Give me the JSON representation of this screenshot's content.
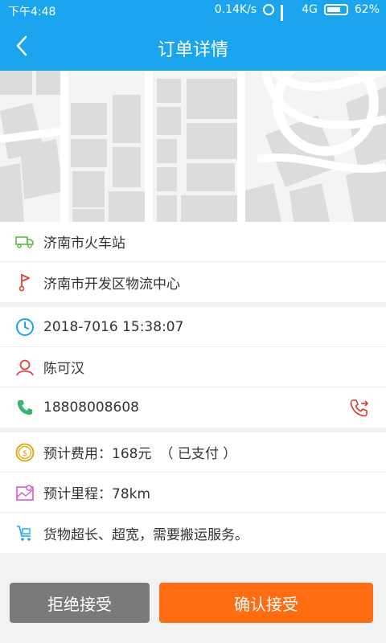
{
  "status_bar": {
    "time": "下午4:48",
    "speed": "0.14K/s",
    "network": "4G",
    "battery": "62%"
  },
  "header": {
    "title": "订单详情"
  },
  "route": {
    "from": "济南市火车站",
    "to": "济南市开发区物流中心"
  },
  "order": {
    "datetime": "2018-7016  15:38:07",
    "contact_name": "陈可汉",
    "phone": "18808008608"
  },
  "details": {
    "fee": "预计费用：168元",
    "paid_status": "（ 已支付 ）",
    "mileage": "预计里程：78km",
    "note": "货物超长、超宽，需要搬运服务。"
  },
  "actions": {
    "reject": "拒绝接受",
    "confirm": "确认接受"
  },
  "colors": {
    "primary": "#1aa5ee",
    "confirm": "#ff6c12",
    "reject": "#7a7a7a",
    "paid": "#f0a000"
  },
  "icons": {
    "truck": "truck-icon",
    "destination": "flag-pin-icon",
    "time": "clock-icon",
    "person": "person-icon",
    "phone": "phone-icon",
    "fee": "coin-icon",
    "mileage": "map-distance-icon",
    "cargo": "cart-icon",
    "call": "call-transfer-icon"
  }
}
